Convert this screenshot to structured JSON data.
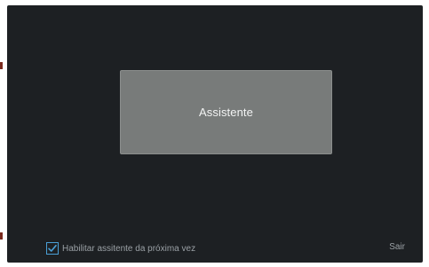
{
  "wizard": {
    "tile_label": "Assistente"
  },
  "footer": {
    "checkbox_label": "Habilitar assitente da próxima vez",
    "checkbox_checked": true,
    "exit_label": "Sair"
  },
  "colors": {
    "background": "#1d2023",
    "tile": "#787b7a",
    "checkbox_accent": "#4a9fd6",
    "footer_text": "#9aa0a5"
  },
  "icons": {
    "checkbox": "checkmark-icon"
  }
}
